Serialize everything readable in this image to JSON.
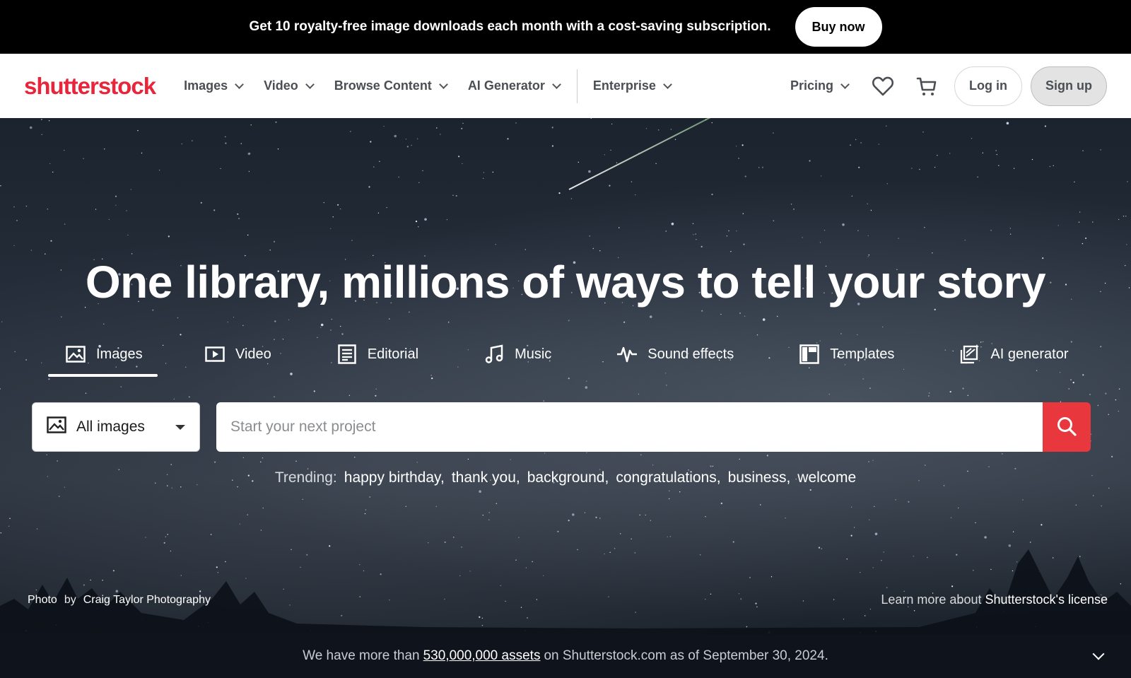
{
  "promo": {
    "text": "Get 10 royalty-free image downloads each month with a cost-saving subscription.",
    "button": "Buy now"
  },
  "header": {
    "logo": "shutterstock",
    "nav": [
      {
        "label": "Images",
        "icon": "chevron-down-icon"
      },
      {
        "label": "Video",
        "icon": "chevron-down-icon"
      },
      {
        "label": "Browse Content",
        "icon": "chevron-down-icon"
      },
      {
        "label": "AI Generator",
        "icon": "chevron-down-icon"
      },
      {
        "label": "Enterprise",
        "icon": "chevron-down-icon"
      }
    ],
    "pricing": "Pricing",
    "login": "Log in",
    "signup": "Sign up",
    "brand_color": "#e8253b"
  },
  "hero": {
    "headline": "One library, millions of ways to tell your story",
    "tabs": [
      {
        "label": "Images",
        "icon": "image-icon",
        "active": true
      },
      {
        "label": "Video",
        "icon": "video-icon",
        "active": false
      },
      {
        "label": "Editorial",
        "icon": "editorial-icon",
        "active": false
      },
      {
        "label": "Music",
        "icon": "music-icon",
        "active": false
      },
      {
        "label": "Sound effects",
        "icon": "waveform-icon",
        "active": false
      },
      {
        "label": "Templates",
        "icon": "templates-icon",
        "active": false
      },
      {
        "label": "AI generator",
        "icon": "ai-generator-icon",
        "active": false
      }
    ],
    "search": {
      "type_value": "All images",
      "placeholder": "Start your next project",
      "button_color": "#e8383d"
    },
    "trending": {
      "label": "Trending:",
      "terms": [
        "happy birthday,",
        "thank you,",
        "background,",
        "congratulations,",
        "business,",
        "welcome"
      ]
    },
    "credit": {
      "photo": "Photo",
      "by": "by",
      "author": "Craig Taylor Photography"
    },
    "license": {
      "prefix": "Learn more about",
      "link": "Shutterstock's license"
    }
  },
  "stats": {
    "prefix": "We have more than",
    "link": "530,000,000 assets",
    "suffix": "on Shutterstock.com as of September 30, 2024."
  }
}
